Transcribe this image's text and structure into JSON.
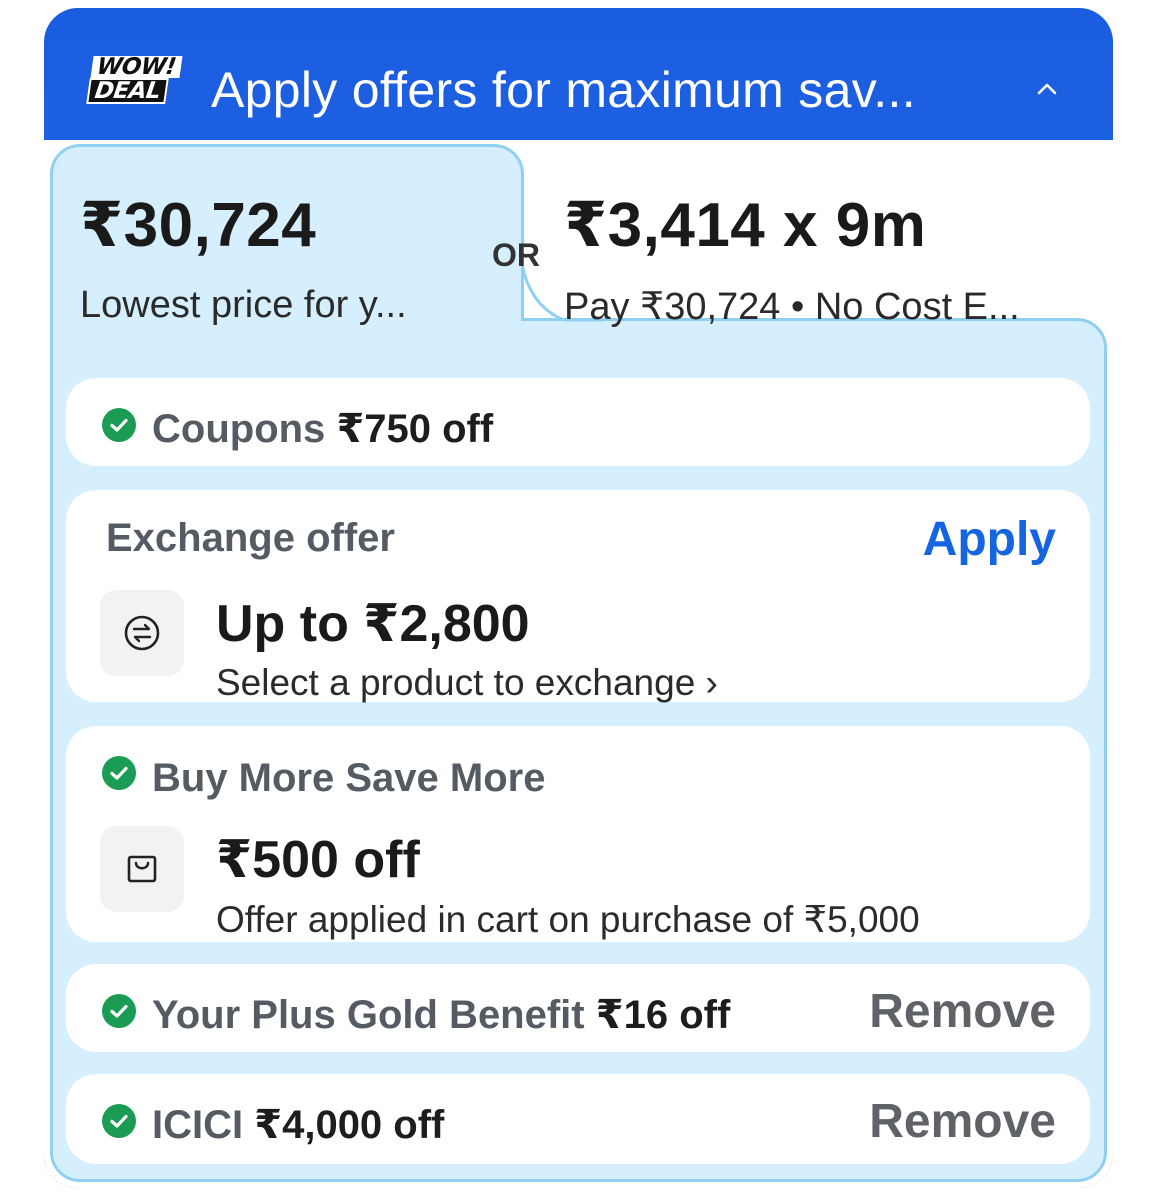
{
  "header": {
    "badge_line1": "WOW!",
    "badge_line2": "DEAL",
    "title": "Apply offers for maximum sav..."
  },
  "pricing": {
    "price": "₹30,724",
    "price_note": "Lowest price for y...",
    "or": "OR",
    "emi": "₹3,414 x 9m",
    "emi_note": "Pay ₹30,724 • No Cost E..."
  },
  "coupons": {
    "label": "Coupons",
    "value": "₹750 off"
  },
  "exchange": {
    "label": "Exchange offer",
    "action": "Apply",
    "value": "Up to ₹2,800",
    "detail": "Select a product to exchange ›"
  },
  "buy_more": {
    "label": "Buy More Save More",
    "value": "₹500 off",
    "detail": "Offer applied in cart on purchase of ₹5,000"
  },
  "plus_gold": {
    "label": "Your Plus Gold Benefit",
    "value": "₹16 off",
    "action": "Remove"
  },
  "icici": {
    "label": "ICICI",
    "value": "₹4,000 off",
    "action": "Remove"
  },
  "colors": {
    "header_blue": "#1a5de0",
    "panel_blue": "#d6efff",
    "apply_blue": "#1565e0",
    "check_green": "#1a9c55",
    "remove_gray": "#5f6368"
  },
  "icons": [
    "wow-deal-badge",
    "chevron-up-icon",
    "check-circle-icon",
    "exchange-icon",
    "cart-bag-icon"
  ]
}
